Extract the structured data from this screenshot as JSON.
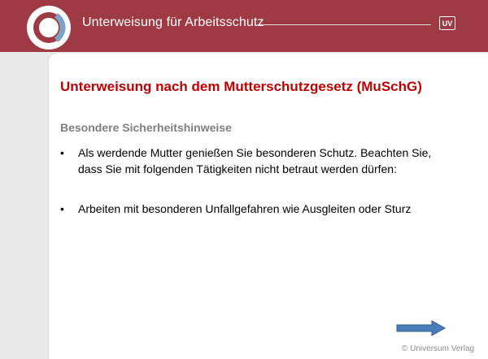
{
  "header": {
    "title": "Unterweisung für Arbeitsschutz",
    "badge": "UV",
    "logo_icon": "ring-logo-icon",
    "badge_icon": "uv-badge-icon"
  },
  "slide": {
    "title": "Unterweisung nach dem Mutterschutzgesetz (MuSchG)",
    "section_heading": "Besondere Sicherheitshinweise",
    "bullets": [
      {
        "marker": "•",
        "text": "Als werdende Mutter genießen Sie besonderen Schutz. Beachten Sie,\ndass Sie mit folgenden Tätigkeiten nicht betraut werden dürfen:"
      },
      {
        "marker": "•",
        "text": "Arbeiten mit besonderen Unfallgefahren wie Ausgleiten oder Sturz"
      }
    ]
  },
  "navigation": {
    "next_icon": "arrow-right-icon"
  },
  "footer": {
    "copyright": "© Universum Verlag"
  },
  "colors": {
    "header_background": "#9e3a43",
    "title_red": "#c00000",
    "heading_gray": "#7f7f7f",
    "arrow_blue": "#4a7ebb",
    "page_gray": "#e9e9e9"
  }
}
